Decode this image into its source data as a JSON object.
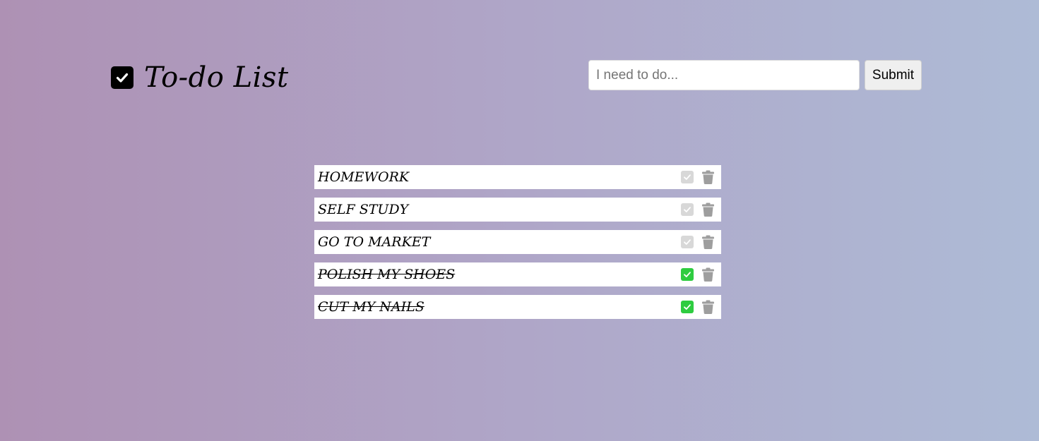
{
  "header": {
    "logo_icon": "check-square-icon",
    "title": "To-do List"
  },
  "form": {
    "input_placeholder": "I need to do...",
    "input_value": "",
    "submit_label": "Submit"
  },
  "colors": {
    "done_check": "#2ecc40",
    "pending_check": "#d8d8d8",
    "trash": "#9e9e9e"
  },
  "todos": [
    {
      "text": "HOMEWORK",
      "done": false
    },
    {
      "text": "SELF STUDY",
      "done": false
    },
    {
      "text": "GO TO MARKET",
      "done": false
    },
    {
      "text": "POLISH MY SHOES",
      "done": true
    },
    {
      "text": "CUT MY NAILS",
      "done": true
    }
  ]
}
